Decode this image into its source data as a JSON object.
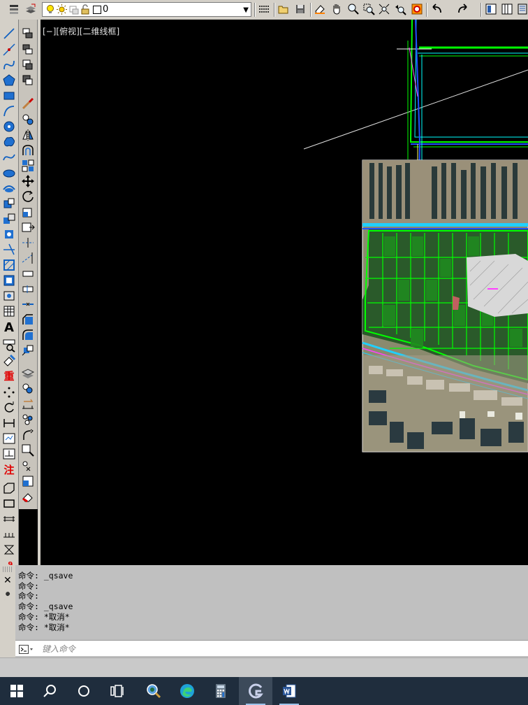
{
  "top_toolbar": {
    "layer_current": "0",
    "icons": [
      "layer-manager-icon",
      "layer-state-icon",
      "lightbulb-icon",
      "sun-icon",
      "freeze-icon",
      "lock-icon",
      "color-swatch-icon"
    ]
  },
  "viewport": {
    "label": "[−][俯视][二维线框]"
  },
  "left_toolbar": {
    "text_tool_label": "A",
    "red_labels": [
      "重",
      "注"
    ]
  },
  "command_history": [
    "命令: _qsave",
    "命令:",
    "命令:",
    "命令: _qsave",
    "命令: *取消*",
    "命令: *取消*"
  ],
  "command_input": {
    "placeholder": "键入命令"
  },
  "taskbar": {
    "apps": [
      "start-icon",
      "search-icon",
      "cortana-icon",
      "task-view-icon",
      "search-app-icon",
      "edge-icon",
      "calculator-icon",
      "gstarcad-icon",
      "word-icon"
    ]
  },
  "colors": {
    "toolbar_bg": "#d4d0c8",
    "canvas_bg": "#000000",
    "taskbar_bg": "#1f2d3d",
    "cad_green": "#00ff00",
    "cad_cyan": "#00ffff"
  }
}
